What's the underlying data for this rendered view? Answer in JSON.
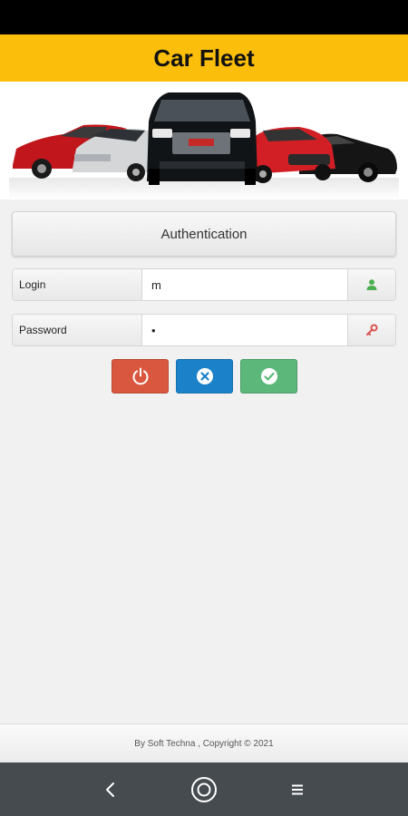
{
  "app": {
    "title": "Car Fleet"
  },
  "banner": {
    "image": "car-fleet-banner",
    "cars": [
      "red-hatchback",
      "silver-sedan",
      "black-suv",
      "red-sedan",
      "black-sedan"
    ]
  },
  "auth": {
    "title": "Authentication"
  },
  "login": {
    "label": "Login",
    "value": "m",
    "icon": "user-icon",
    "icon_color": "#4caf50"
  },
  "password": {
    "label": "Password",
    "value": "•",
    "icon": "key-icon",
    "icon_color": "#d9534f"
  },
  "buttons": {
    "power": {
      "icon": "power-icon",
      "color": "#d9573e"
    },
    "cancel": {
      "icon": "close-circle-icon",
      "color": "#1b82c9"
    },
    "confirm": {
      "icon": "check-circle-icon",
      "color": "#5cb87a"
    }
  },
  "footer": {
    "text": "By Soft Techna , Copyright © 2021"
  },
  "nav": {
    "back": "back-icon",
    "home": "home-icon",
    "menu": "menu-icon"
  },
  "colors": {
    "header": "#fbbe0b",
    "status_bar": "#000000",
    "nav_bar": "#464b50"
  }
}
